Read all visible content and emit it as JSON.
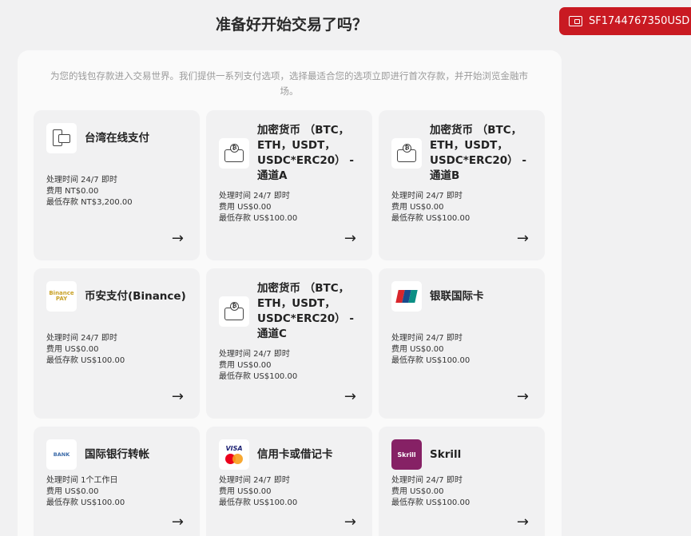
{
  "header": {
    "title": "准备好开始交易了吗？",
    "account_label": "SF1744767350USD",
    "accent_color": "#c91a22"
  },
  "intro": "为您的钱包存款进入交易世界。我们提供一系列支付选项，选择最适合您的选项立即进行首次存款，并开始浏览金融市场。",
  "methods": [
    {
      "title": "台湾在线支付",
      "icon": "mobile-wallet-icon",
      "time": "处理时间 24/7 即时",
      "fee": "费用 NT$0.00",
      "min": "最低存款 NT$3,200.00"
    },
    {
      "title": "加密货币 （BTC，ETH，USDT，USDC*ERC20） - 通道A",
      "icon": "crypto-wallet-icon",
      "time": "处理时间 24/7 即时",
      "fee": "费用 US$0.00",
      "min": "最低存款 US$100.00"
    },
    {
      "title": "加密货币 （BTC，ETH，USDT，USDC*ERC20） - 通道B",
      "icon": "crypto-wallet-icon",
      "time": "处理时间 24/7 即时",
      "fee": "费用 US$0.00",
      "min": "最低存款 US$100.00"
    },
    {
      "title": "币安支付(Binance)",
      "icon": "binance-pay-icon",
      "logo_text": "Binance PAY",
      "time": "处理时间 24/7 即时",
      "fee": "费用 US$0.00",
      "min": "最低存款 US$100.00"
    },
    {
      "title": "加密货币 （BTC，ETH，USDT，USDC*ERC20） - 通道C",
      "icon": "crypto-wallet-icon",
      "time": "处理时间 24/7 即时",
      "fee": "费用 US$0.00",
      "min": "最低存款 US$100.00"
    },
    {
      "title": "银联国际卡",
      "icon": "unionpay-icon",
      "time": "处理时间 24/7 即时",
      "fee": "费用 US$0.00",
      "min": "最低存款 US$100.00"
    },
    {
      "title": "国际银行转帐",
      "icon": "bank-transfer-icon",
      "logo_text": "BANK",
      "time": "处理时间 1个工作日",
      "fee": "费用 US$0.00",
      "min": "最低存款 US$100.00"
    },
    {
      "title": "信用卡或借记卡",
      "icon": "visa-mastercard-icon",
      "logo_text": "VISA",
      "time": "处理时间 24/7 即时",
      "fee": "费用 US$0.00",
      "min": "最低存款 US$100.00"
    },
    {
      "title": "Skrill",
      "icon": "skrill-icon",
      "logo_text": "Skrill",
      "time": "处理时间 24/7 即时",
      "fee": "费用 US$0.00",
      "min": "最低存款 US$100.00"
    }
  ]
}
